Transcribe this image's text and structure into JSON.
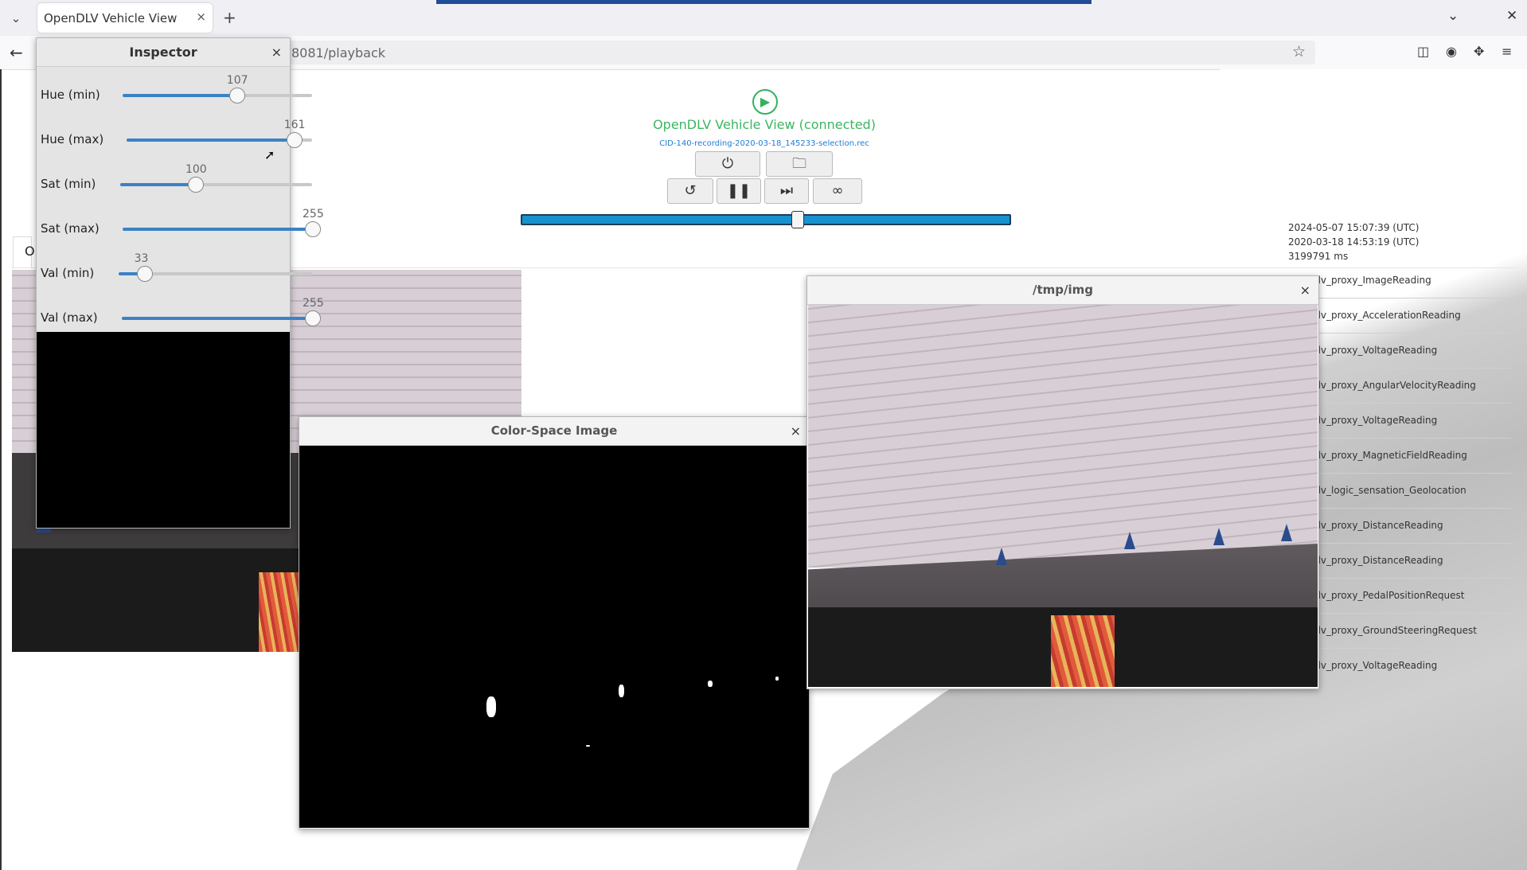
{
  "browser": {
    "tab_title": "OpenDLV Vehicle View",
    "tab_close": "×",
    "new_tab": "+",
    "url": "8081/playback",
    "tab_list_icon": "⌄",
    "minimize_icon": "⌄",
    "close_icon": "✕",
    "back_icon": "←",
    "star_icon": "☆"
  },
  "header": {
    "play_icon": "▶",
    "title": "OpenDLV Vehicle View (connected)",
    "file": "CID-140-recording-2020-03-18_145233-selection.rec",
    "buttons": {
      "power": "⏻",
      "open": "🗀",
      "replay": "↺",
      "pause": "❚❚",
      "step": "⏭",
      "loop": "∞"
    },
    "progress_fraction": 0.564
  },
  "page": {
    "tab_stub": "O"
  },
  "right_column": {
    "timestamps": [
      "2024-05-07 15:07:39 (UTC)",
      "2020-03-18 14:53:19 (UTC)",
      "3199791 ms"
    ],
    "messages": [
      "opendlv_proxy_ImageReading",
      "opendlv_proxy_AccelerationReading",
      "opendlv_proxy_VoltageReading",
      "opendlv_proxy_AngularVelocityReading",
      "opendlv_proxy_VoltageReading",
      "opendlv_proxy_MagneticFieldReading",
      "opendlv_logic_sensation_Geolocation",
      "opendlv_proxy_DistanceReading",
      "opendlv_proxy_DistanceReading",
      "opendlv_proxy_PedalPositionRequest",
      "opendlv_proxy_GroundSteeringRequest",
      "opendlv_proxy_VoltageReading"
    ]
  },
  "inspector": {
    "title": "Inspector",
    "close": "×",
    "sliders": [
      {
        "label": "Hue (min)",
        "value": "107",
        "fraction": 0.6
      },
      {
        "label": "Hue (max)",
        "value": "161",
        "fraction": 0.9
      },
      {
        "label": "Sat (min)",
        "value": "100",
        "fraction": 0.39
      },
      {
        "label": "Sat (max)",
        "value": "255",
        "fraction": 1.0
      },
      {
        "label": "Val (min)",
        "value": "33",
        "fraction": 0.13
      },
      {
        "label": "Val (max)",
        "value": "255",
        "fraction": 1.0
      }
    ]
  },
  "colorspace": {
    "title": "Color-Space Image",
    "close": "×"
  },
  "tmpimg": {
    "title": "/tmp/img",
    "close": "×"
  }
}
